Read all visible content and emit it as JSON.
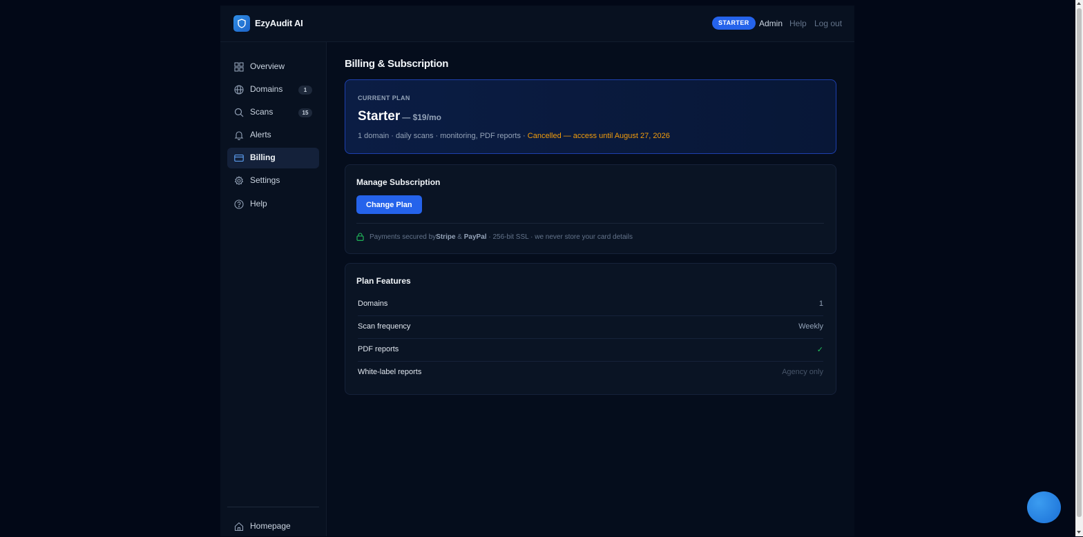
{
  "header": {
    "brand": "EzyAudit AI",
    "plan_badge": "STARTER",
    "links": {
      "admin": "Admin",
      "help": "Help",
      "logout": "Log out"
    }
  },
  "sidebar": {
    "items": [
      {
        "label": "Overview",
        "icon": "grid-icon"
      },
      {
        "label": "Domains",
        "icon": "globe-icon",
        "count": "1"
      },
      {
        "label": "Scans",
        "icon": "search-icon",
        "count": "15"
      },
      {
        "label": "Alerts",
        "icon": "bell-icon"
      },
      {
        "label": "Billing",
        "icon": "credit-card-icon",
        "active": true
      },
      {
        "label": "Settings",
        "icon": "gear-icon"
      },
      {
        "label": "Help",
        "icon": "help-circle-icon"
      }
    ],
    "footer": {
      "label": "Homepage",
      "icon": "home-icon"
    }
  },
  "main": {
    "title": "Billing & Subscription",
    "current_plan": {
      "label": "CURRENT PLAN",
      "name": "Starter",
      "price": "— $19/mo",
      "description": "1 domain · daily scans · monitoring, PDF reports · ",
      "status": "Cancelled — access until August 27, 2026"
    },
    "manage": {
      "title": "Manage Subscription",
      "change_plan": "Change Plan",
      "secure_prefix": "Payments secured by ",
      "stripe": "Stripe",
      "amp": " & ",
      "paypal": "PayPal",
      "secure_suffix": " · 256-bit SSL · we never store your card details"
    },
    "features": {
      "title": "Plan Features",
      "rows": [
        {
          "name": "Domains",
          "value": "1"
        },
        {
          "name": "Scan frequency",
          "value": "Weekly"
        },
        {
          "name": "PDF reports",
          "value": "✓"
        },
        {
          "name": "White-label reports",
          "value": "Agency only"
        }
      ]
    }
  },
  "colors": {
    "accent": "#2563eb",
    "cancelled": "#f59e0b",
    "check": "#22c55e",
    "background": "#020817"
  }
}
